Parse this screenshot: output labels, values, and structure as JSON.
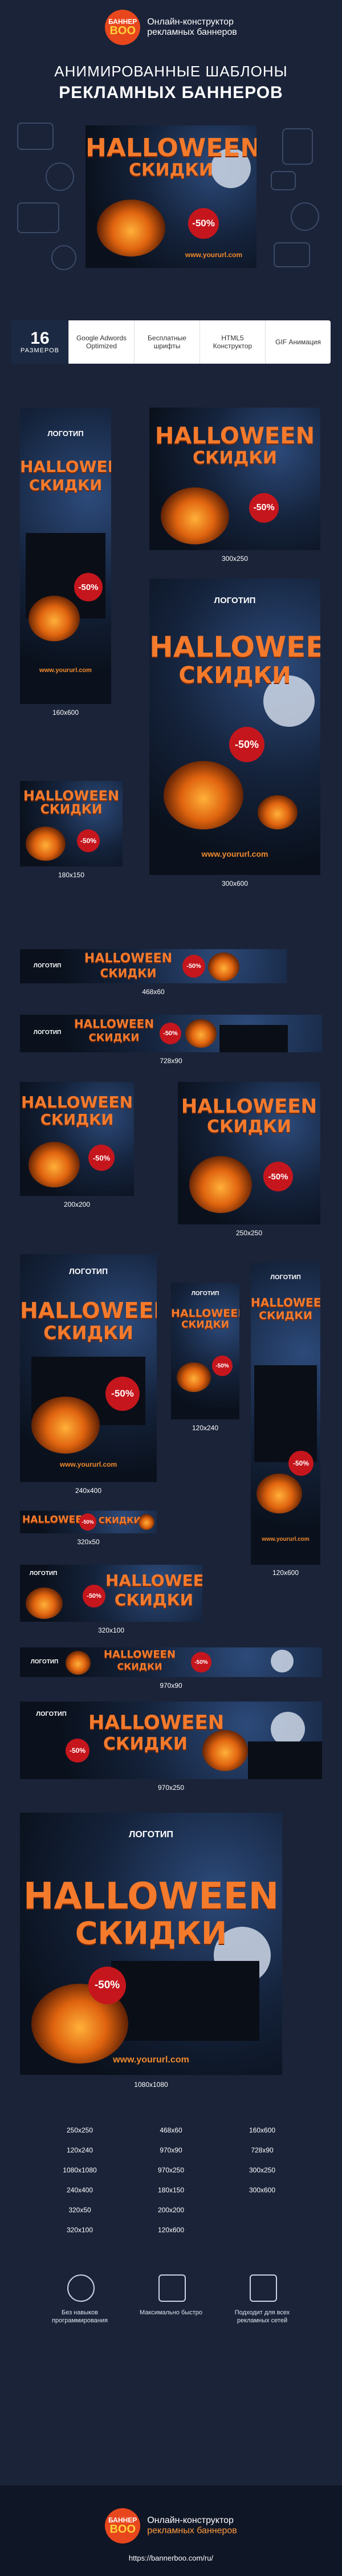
{
  "header": {
    "logo_line1": "БАННЕР",
    "logo_line2": "BOO",
    "tagline_1": "Онлайн-конструктор",
    "tagline_2": "рекламных баннеров",
    "title_1": "АНИМИРОВАННЫЕ ШАБЛОНЫ",
    "title_2": "РЕКЛАМНЫХ БАННЕРОВ"
  },
  "hero": {
    "title_1": "HALLOWEEN",
    "title_2": "СКИДКИ",
    "discount": "-50%",
    "url": "www.yoururl.com"
  },
  "features": {
    "count": "16",
    "count_label": "РАЗМЕРОВ",
    "items": [
      "Google Adwords Optimized",
      "Бесплатные шрифты",
      "HTML5 Конструктор",
      "GIF Анимация"
    ]
  },
  "banner_text": {
    "logo": "ЛОГОТИП",
    "title_1": "HALLOWEEN",
    "title_2": "СКИДКИ",
    "discount": "-50%",
    "url": "www.yoururl.com"
  },
  "captions": {
    "c160x600": "160x600",
    "c300x250": "300x250",
    "c180x150": "180x150",
    "c300x600": "300x600",
    "c468x60": "468x60",
    "c728x90": "728x90",
    "c200x200": "200x200",
    "c250x250": "250x250",
    "c240x400": "240x400",
    "c120x240": "120x240",
    "c120x600": "120x600",
    "c320x50": "320x50",
    "c320x100": "320x100",
    "c970x90": "970x90",
    "c970x250": "970x250",
    "c1080x1080": "1080x1080"
  },
  "sizes_list": [
    [
      "250x250",
      "468x60",
      "160x600"
    ],
    [
      "120x240",
      "970x90",
      "728x90"
    ],
    [
      "1080x1080",
      "970x250",
      "300x250"
    ],
    [
      "240x400",
      "180x150",
      "300x600"
    ],
    [
      "320x50",
      "200x200",
      ""
    ],
    [
      "320x100",
      "120x600",
      ""
    ]
  ],
  "bottom_features": [
    "Без навыков программирования",
    "Максимально быстро",
    "Подходит для всех рекламных сетей"
  ],
  "footer": {
    "tagline_1": "Онлайн-конструктор",
    "tagline_2": "рекламных баннеров",
    "url": "https://bannerboo.com/ru/"
  },
  "colors": {
    "background": "#1a2338",
    "accent_orange": "#f47a2c",
    "discount_red": "#c6161d",
    "logo_orange": "#e8471e"
  }
}
